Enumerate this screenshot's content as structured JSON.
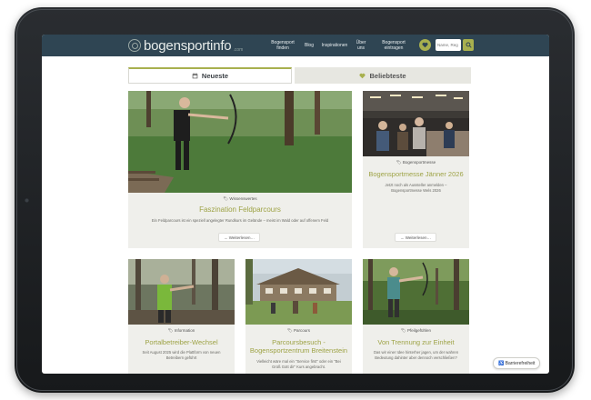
{
  "header": {
    "logo_text": "bogensportinfo",
    "logo_sub": ".com",
    "nav": [
      {
        "line1": "Bogensport",
        "line2": "finden"
      },
      {
        "line1": "Blog",
        "line2": ""
      },
      {
        "line1": "Inspirationen",
        "line2": ""
      },
      {
        "line1": "Über",
        "line2": "uns"
      },
      {
        "line1": "Bogensport",
        "line2": "eintragen"
      }
    ],
    "search_placeholder": "Name, Reg"
  },
  "tabs": [
    {
      "label": "Neueste",
      "icon": "calendar-icon",
      "active": true
    },
    {
      "label": "Beliebteste",
      "icon": "heart-icon",
      "active": false
    }
  ],
  "cards": [
    {
      "category": "Wissenswertes",
      "title": "Faszination Feldparcours",
      "excerpt": "Ein Feldparcours ist ein speziell angelegter Rundkurs im Gelände – meist im Wald oder auf offenem Feld",
      "more": "Weiterlesen…"
    },
    {
      "category": "Bogensportmesse",
      "title": "Bogensportmesse Jänner 2026",
      "excerpt": "Jetzt noch als Aussteller anmelden – Bogensportmesse Wels 2026",
      "more": "Weiterlesen…"
    },
    {
      "category": "Information",
      "title": "Portalbetreiber-Wechsel",
      "excerpt": "Seit August 2025 wird die Plattform von neuen Betreibern geführt",
      "more": ""
    },
    {
      "category": "Parcours",
      "title": "Parcoursbesuch - Bogensportzentrum Breitenstein",
      "excerpt": "Vielleicht wäre mal ein \"Service first\" oder ein \"Bei Grüß Gott dir\" Kurs angebracht.",
      "more": ""
    },
    {
      "category": "Pfeilgefühlen",
      "title": "Von Trennung zur Einheit",
      "excerpt": "Das wir einer Idee hinterher jagen, um der wahren Bedeutung dahinter aber dennoch verschließen?",
      "more": ""
    }
  ],
  "accessibility_label": "Barrierefreiheit",
  "colors": {
    "header": "#2f4553",
    "accent": "#a8b04e",
    "title": "#9ea346",
    "card": "#efefeb"
  }
}
